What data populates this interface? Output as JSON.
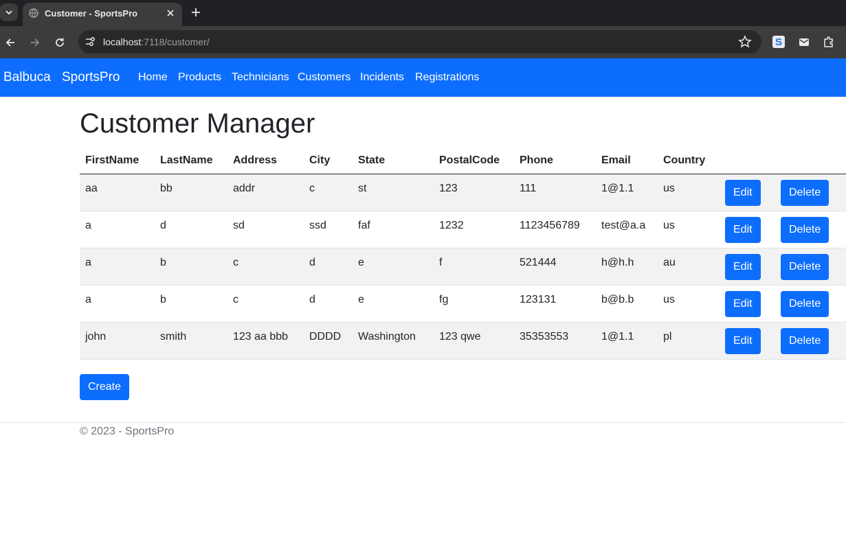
{
  "browser": {
    "tab_title": "Customer - SportsPro",
    "url_host": "localhost",
    "url_rest": ":7118/customer/"
  },
  "navbar": {
    "brand1": "Balbuca",
    "brand2": "SportsPro",
    "links": [
      "Home",
      "Products",
      "Technicians",
      "Customers",
      "Incidents",
      "Registrations"
    ]
  },
  "page": {
    "title": "Customer Manager",
    "headers": [
      "FirstName",
      "LastName",
      "Address",
      "City",
      "State",
      "PostalCode",
      "Phone",
      "Email",
      "Country"
    ],
    "rows": [
      [
        "aa",
        "bb",
        "addr",
        "c",
        "st",
        "123",
        "111",
        "1@1.1",
        "us"
      ],
      [
        "a",
        "d",
        "sd",
        "ssd",
        "faf",
        "1232",
        "1123456789",
        "test@a.a",
        "us"
      ],
      [
        "a",
        "b",
        "c",
        "d",
        "e",
        "f",
        "521444",
        "h@h.h",
        "au"
      ],
      [
        "a",
        "b",
        "c",
        "d",
        "e",
        "fg",
        "123131",
        "b@b.b",
        "us"
      ],
      [
        "john",
        "smith",
        "123 aa bbb",
        "DDDD",
        "Washington",
        "123 qwe",
        "35353553",
        "1@1.1",
        "pl"
      ]
    ],
    "edit_label": "Edit",
    "delete_label": "Delete",
    "create_label": "Create"
  },
  "footer": {
    "text": "© 2023 - SportsPro"
  }
}
